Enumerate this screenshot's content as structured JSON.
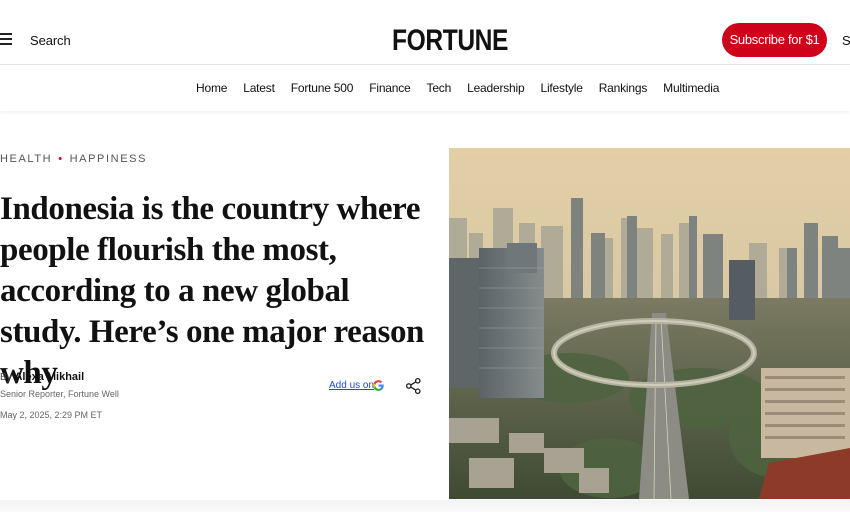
{
  "header": {
    "search_label": "Search",
    "logo_text": "FORTUNE",
    "subscribe_label": "Subscribe for $1",
    "signin_label": "Si"
  },
  "nav": {
    "items": [
      "Home",
      "Latest",
      "Fortune 500",
      "Finance",
      "Tech",
      "Leadership",
      "Lifestyle",
      "Rankings",
      "Multimedia"
    ]
  },
  "article": {
    "category_primary": "HEALTH",
    "category_secondary": "HAPPINESS",
    "headline": "Indonesia is the country where people flourish the most, according to a new global study. Here’s one major reason why",
    "byline_prefix": "By",
    "author": "Alexa Mikhail",
    "author_role": "Senior Reporter, Fortune Well",
    "date": "May 2, 2025, 2:29 PM ET",
    "add_us_label": "Add us on"
  },
  "colors": {
    "accent": "#d0021b",
    "link": "#1a4ed8"
  },
  "icons": {
    "menu": "hamburger-menu-icon",
    "google": "google-g-icon",
    "share": "share-icon"
  }
}
